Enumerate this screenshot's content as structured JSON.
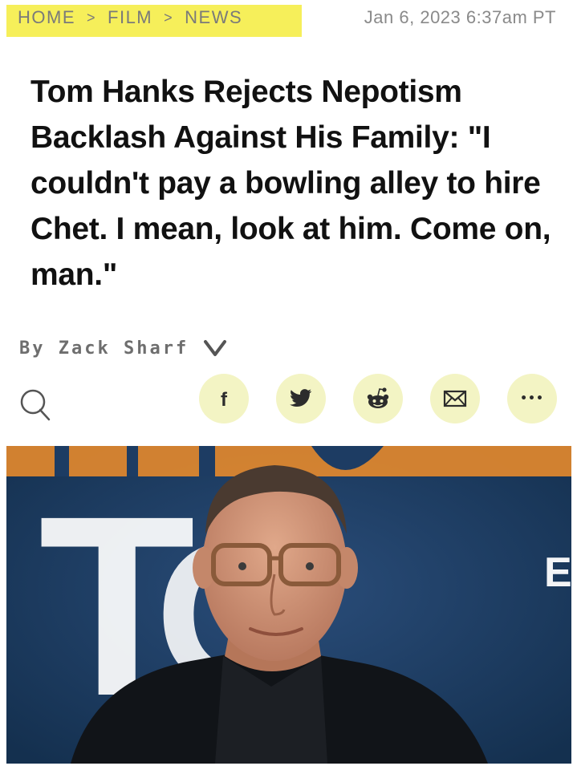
{
  "breadcrumb": {
    "items": [
      "HOME",
      "FILM",
      "NEWS"
    ],
    "separator": ">",
    "highlight_color": "#f6ef5a"
  },
  "article": {
    "date": "Jan 6, 2023 6:37am PT",
    "headline": "Tom Hanks Rejects Nepotism Backlash Against His Family: \"I couldn't pay a bowling alley to hire Chet. I mean, look at him. Come on, man.\"",
    "byline": "By Zack Sharf"
  },
  "toolbar": {
    "search_icon": "search-icon",
    "share_buttons": [
      {
        "icon": "facebook-icon",
        "glyph": "f"
      },
      {
        "icon": "twitter-icon",
        "glyph": ""
      },
      {
        "icon": "reddit-icon",
        "glyph": ""
      },
      {
        "icon": "email-icon",
        "glyph": ""
      },
      {
        "icon": "more-icon",
        "glyph": "•••"
      }
    ],
    "share_bg_color": "#f3f4c4",
    "share_icon_color": "#2c2c2c"
  },
  "hero": {
    "backdrop_letters": [
      "T",
      "O",
      "E"
    ],
    "backdrop_color": "#1d3c63",
    "accent_color": "#e58a2c"
  }
}
